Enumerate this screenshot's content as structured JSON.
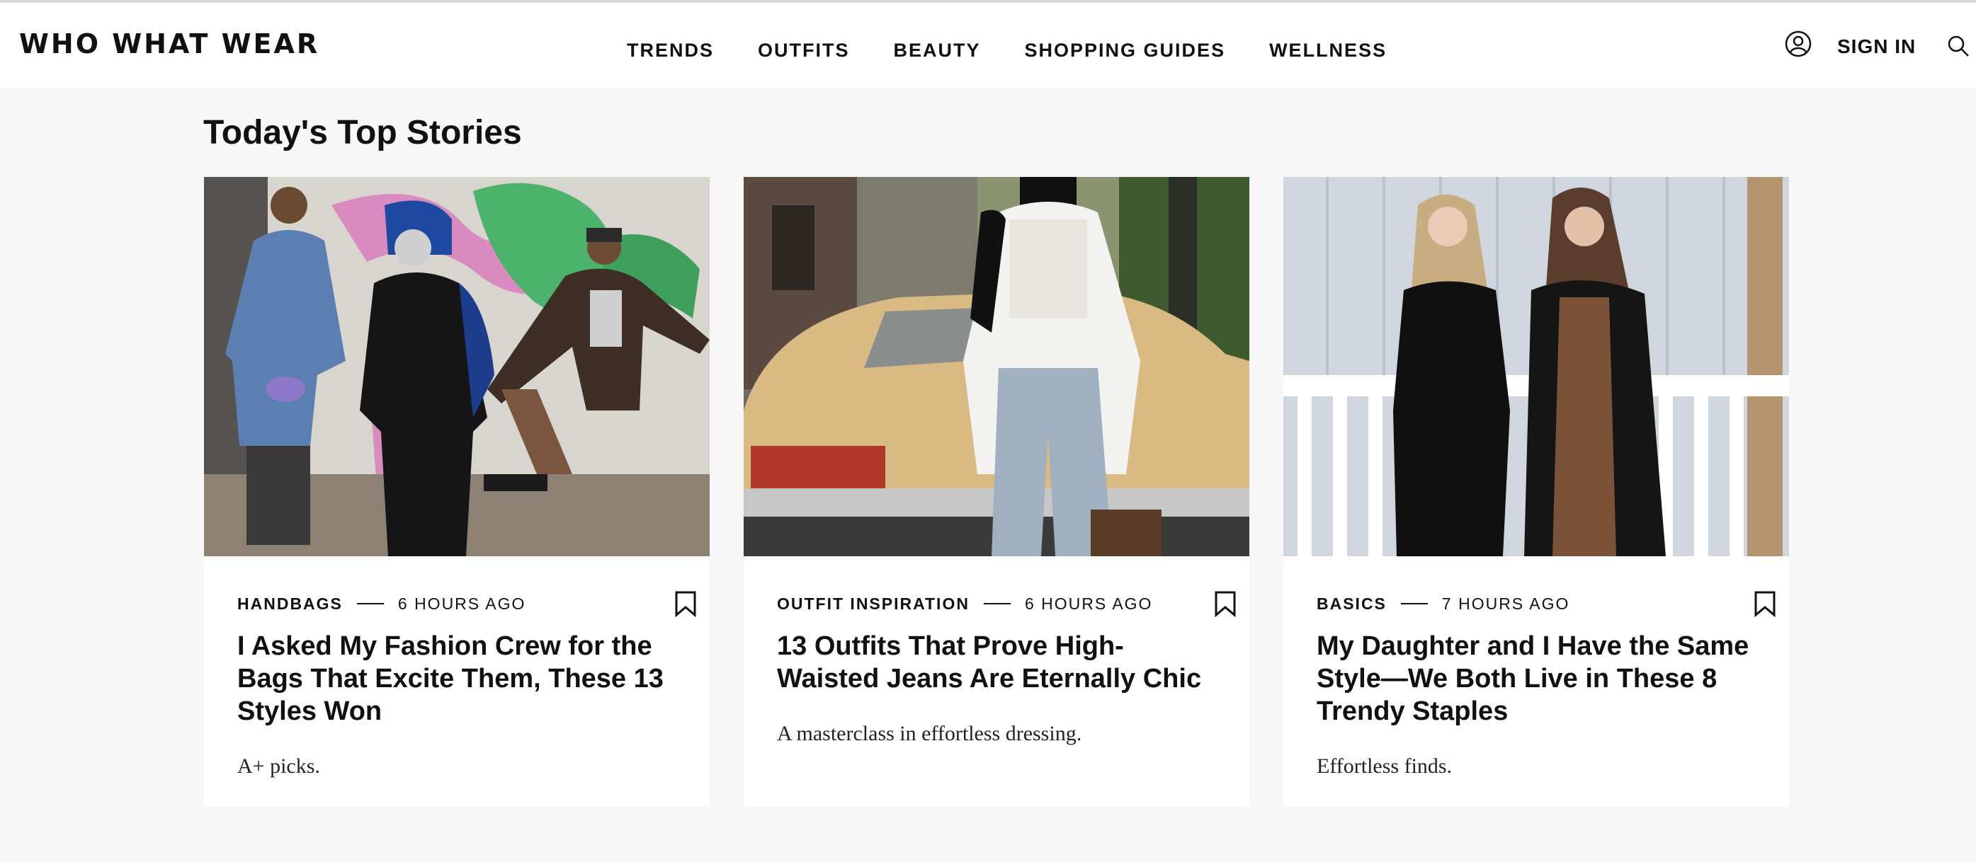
{
  "header": {
    "logo": "WHO WHAT WEAR",
    "nav": [
      "TRENDS",
      "OUTFITS",
      "BEAUTY",
      "SHOPPING GUIDES",
      "WELLNESS"
    ],
    "sign_in": "SIGN IN",
    "icons": [
      "account-icon",
      "search-icon"
    ]
  },
  "main": {
    "section_title": "Today's Top Stories",
    "stories": [
      {
        "category": "HANDBAGS",
        "time": "6 HOURS AGO",
        "headline": "I Asked My Fashion Crew for the Bags That Excite Them, These 13 Styles Won",
        "dek": "A+ picks."
      },
      {
        "category": "OUTFIT INSPIRATION",
        "time": "6 HOURS AGO",
        "headline": "13 Outfits That Prove High-Waisted Jeans Are Eternally Chic",
        "dek": "A masterclass in effortless dressing."
      },
      {
        "category": "BASICS",
        "time": "7 HOURS AGO",
        "headline": "My Daughter and I Have the Same Style—We Both Live in These 8 Trendy Staples",
        "dek": "Effortless finds."
      }
    ]
  },
  "colors": {
    "page_bg": "#f7f7f7",
    "card_bg": "#ffffff",
    "text": "#111111"
  }
}
